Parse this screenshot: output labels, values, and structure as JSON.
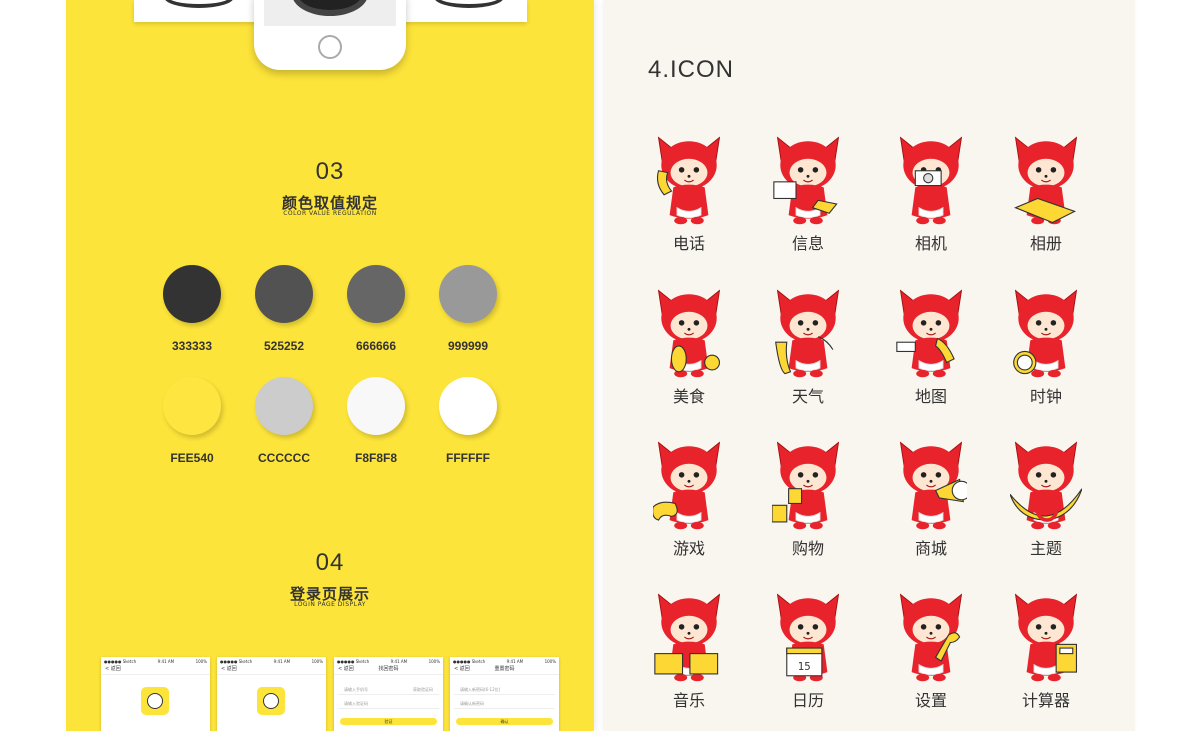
{
  "colors": {
    "page_bg": "#ffffff",
    "left_panel_bg": "#fde43a",
    "right_panel_bg": "#f9f5ef",
    "fox_red": "#e8232b",
    "fox_cream": "#fde7d2",
    "prop_yellow": "#fdd835"
  },
  "color_section": {
    "number": "03",
    "title": "颜色取值规定",
    "subtitle": "COLOR VALUE REGULATION",
    "swatches": [
      {
        "hex": "#333333",
        "label": "333333"
      },
      {
        "hex": "#525252",
        "label": "525252"
      },
      {
        "hex": "#666666",
        "label": "666666"
      },
      {
        "hex": "#999999",
        "label": "999999"
      },
      {
        "hex": "#FEE540",
        "label": "FEE540"
      },
      {
        "hex": "#CCCCCC",
        "label": "CCCCCC"
      },
      {
        "hex": "#F8F8F8",
        "label": "F8F8F8"
      },
      {
        "hex": "#FFFFFF",
        "label": "FFFFFF"
      }
    ]
  },
  "login_section": {
    "number": "04",
    "title": "登录页展示",
    "subtitle": "LOGIN PAGE DISPLAY",
    "screens": [
      {
        "status_left": "●●●●● Sketch",
        "status_time": "9:41 AM",
        "status_right": "100%",
        "back": "< 返回",
        "nav_title": "",
        "type": "logo"
      },
      {
        "status_left": "●●●●● Sketch",
        "status_time": "9:41 AM",
        "status_right": "100%",
        "back": "< 返回",
        "nav_title": "",
        "type": "logo"
      },
      {
        "status_left": "●●●●● Sketch",
        "status_time": "9:41 AM",
        "status_right": "100%",
        "back": "< 返回",
        "nav_title": "找回密码",
        "type": "form",
        "field1": "请输入手机号",
        "field1_extra": "获取验证码",
        "field2": "请输入验证码",
        "button": "验证"
      },
      {
        "status_left": "●●●●● Sketch",
        "status_time": "9:41 AM",
        "status_right": "100%",
        "back": "< 返回",
        "nav_title": "重置密码",
        "type": "form",
        "field1": "请输入新密码(6-12位)",
        "field1_extra": "",
        "field2": "请确认新密码",
        "button": "确认"
      }
    ]
  },
  "icon_section": {
    "heading": "4.ICON",
    "icons": [
      {
        "label": "电话",
        "prop": "phone"
      },
      {
        "label": "信息",
        "prop": "letter"
      },
      {
        "label": "相机",
        "prop": "camera"
      },
      {
        "label": "相册",
        "prop": "album"
      },
      {
        "label": "美食",
        "prop": "food"
      },
      {
        "label": "天气",
        "prop": "umbrella"
      },
      {
        "label": "地图",
        "prop": "binoculars"
      },
      {
        "label": "时钟",
        "prop": "clock"
      },
      {
        "label": "游戏",
        "prop": "gamepad"
      },
      {
        "label": "购物",
        "prop": "bag"
      },
      {
        "label": "商城",
        "prop": "megaphone"
      },
      {
        "label": "主题",
        "prop": "boat"
      },
      {
        "label": "音乐",
        "prop": "drum"
      },
      {
        "label": "日历",
        "prop": "calendar",
        "prop_text": "15"
      },
      {
        "label": "设置",
        "prop": "wrench"
      },
      {
        "label": "计算器",
        "prop": "calculator"
      }
    ]
  }
}
